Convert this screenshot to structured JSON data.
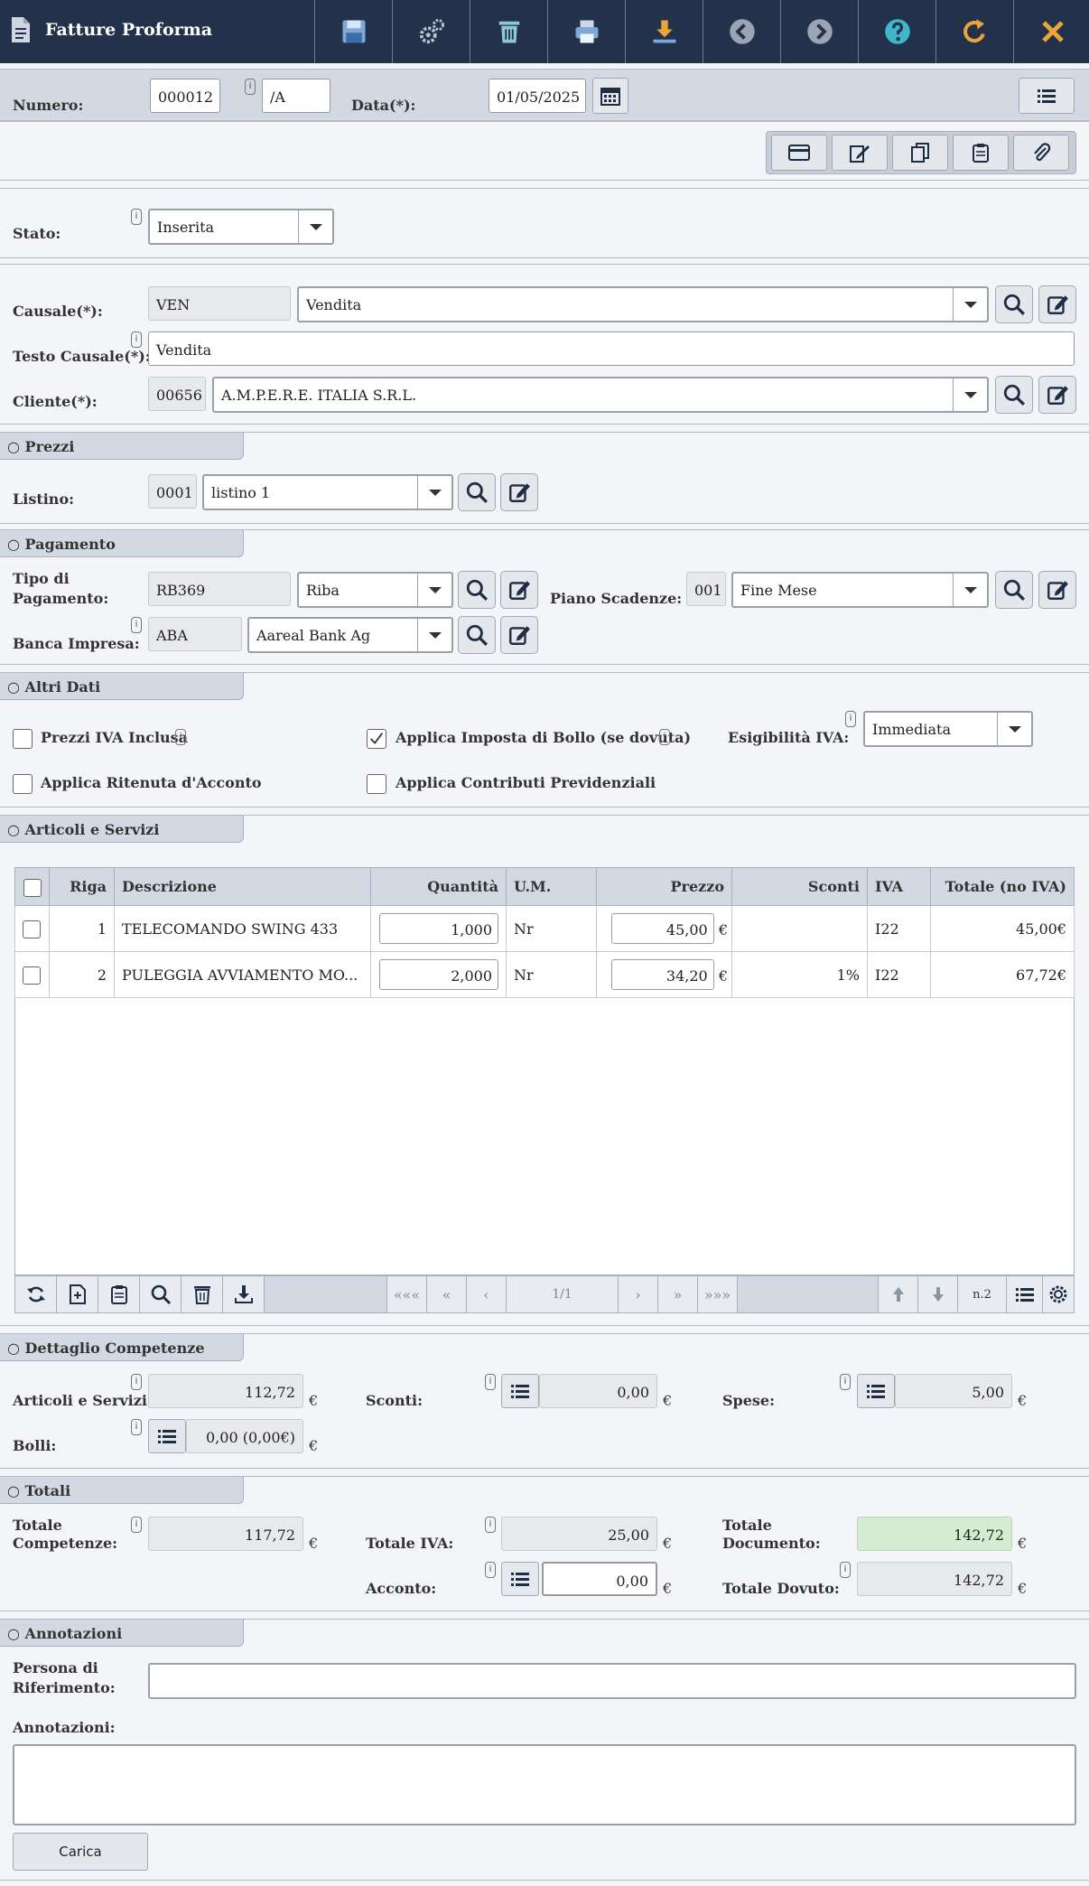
{
  "header": {
    "title": "Fatture Proforma",
    "icons": [
      "save-icon",
      "gears-icon",
      "trash-icon",
      "print-icon",
      "download-icon",
      "prev-icon",
      "next-icon",
      "help-icon",
      "refresh-icon",
      "close-icon"
    ]
  },
  "doc": {
    "numero_label": "Numero:",
    "numero": "000012",
    "suffix": "/A",
    "data_label": "Data(*):",
    "data": "01/05/2025"
  },
  "stato": {
    "label": "Stato:",
    "value": "Inserita"
  },
  "causale": {
    "label": "Causale(*):",
    "code": "VEN",
    "value": "Vendita",
    "testo_label": "Testo Causale(*):",
    "testo": "Vendita",
    "cliente_label": "Cliente(*):",
    "cliente_code": "00656",
    "cliente": "A.M.P.E.R.E. ITALIA S.R.L."
  },
  "prezzi": {
    "title": "○ Prezzi",
    "listino_label": "Listino:",
    "listino_code": "0001",
    "listino": "listino 1"
  },
  "pagamento": {
    "title": "○ Pagamento",
    "tipo_label1": "Tipo di",
    "tipo_label2": "Pagamento:",
    "tipo_code": "RB369",
    "tipo": "Riba",
    "piano_label": "Piano Scadenze:",
    "piano_code": "001",
    "piano": "Fine Mese",
    "banca_label": "Banca Impresa:",
    "banca_code": "ABA",
    "banca": "Aareal Bank Ag"
  },
  "altri": {
    "title": "○ Altri Dati",
    "iva_inclusa": "Prezzi IVA Inclusa",
    "bollo": "Applica Imposta di Bollo (se dovuta)",
    "esig_label": "Esigibilità IVA:",
    "esig": "Immediata",
    "ritenuta": "Applica Ritenuta d'Acconto",
    "contributi": "Applica Contributi Previdenziali"
  },
  "articoli": {
    "title": "○ Articoli e Servizi",
    "columns": {
      "riga": "Riga",
      "descr": "Descrizione",
      "qta": "Quantità",
      "um": "U.M.",
      "prezzo": "Prezzo",
      "sconti": "Sconti",
      "iva": "IVA",
      "totale": "Totale (no IVA)"
    },
    "rows": [
      {
        "riga": "1",
        "descr": "TELECOMANDO SWING 433",
        "qta": "1,000",
        "um": "Nr",
        "prezzo": "45,00",
        "cur": "€",
        "sconti": "",
        "iva": "I22",
        "totale": "45,00€"
      },
      {
        "riga": "2",
        "descr": "PULEGGIA AVVIAMENTO MO...",
        "qta": "2,000",
        "um": "Nr",
        "prezzo": "34,20",
        "cur": "€",
        "sconti": "1%",
        "iva": "I22",
        "totale": "67,72€"
      }
    ],
    "pager": {
      "first": "«««",
      "prev2": "«",
      "prev": "‹",
      "page": "1/1",
      "next": "›",
      "next2": "»",
      "last": "»»»",
      "count": "n.2"
    }
  },
  "competenze": {
    "title": "○ Dettaglio Competenze",
    "articoli_label": "Articoli e Servizi:",
    "articoli": "112,72",
    "sconti_label": "Sconti:",
    "sconti": "0,00",
    "spese_label": "Spese:",
    "spese": "5,00",
    "bolli_label": "Bolli:",
    "bolli": "0,00 (0,00€)",
    "cur": "€"
  },
  "totali": {
    "title": "○ Totali",
    "tot_comp_label1": "Totale",
    "tot_comp_label2": "Competenze:",
    "tot_comp": "117,72",
    "tot_iva_label": "Totale IVA:",
    "tot_iva": "25,00",
    "tot_doc_label1": "Totale",
    "tot_doc_label2": "Documento:",
    "tot_doc": "142,72",
    "acconto_label": "Acconto:",
    "acconto": "0,00",
    "dovuto_label": "Totale Dovuto:",
    "dovuto": "142,72",
    "cur": "€"
  },
  "annotazioni": {
    "title": "○ Annotazioni",
    "persona_label1": "Persona di",
    "persona_label2": "Riferimento:",
    "persona": "",
    "annot_label": "Annotazioni:",
    "annot": "",
    "carica": "Carica"
  },
  "info_glyph": "i",
  "colors": {
    "topbar": "#23324a",
    "section": "#d3d9e3",
    "green": "#d6ecd2"
  }
}
